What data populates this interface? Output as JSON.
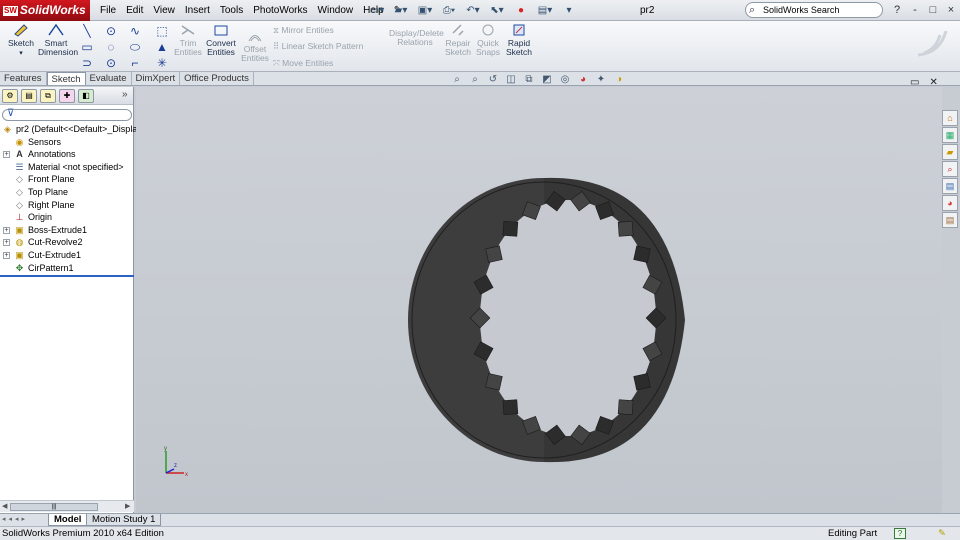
{
  "app": {
    "name": "SolidWorks",
    "logo_text": "SW"
  },
  "menu": [
    "File",
    "Edit",
    "View",
    "Insert",
    "Tools",
    "PhotoWorks",
    "Window",
    "Help"
  ],
  "document_title": "pr2",
  "search": {
    "placeholder": "SolidWorks Search"
  },
  "window_controls": [
    "?",
    "-",
    "□",
    "×"
  ],
  "ribbon": {
    "sketch": "Sketch",
    "smart_dimension_1": "Smart",
    "smart_dimension_2": "Dimension",
    "trim_1": "Trim",
    "trim_2": "Entities",
    "convert_1": "Convert",
    "convert_2": "Entities",
    "offset_1": "Offset",
    "offset_2": "Entities",
    "mirror": "Mirror Entities",
    "linear_pattern": "Linear Sketch Pattern",
    "move": "Move Entities",
    "display_delete_1": "Display/Delete",
    "display_delete_2": "Relations",
    "repair_1": "Repair",
    "repair_2": "Sketch",
    "quick_snaps_1": "Quick",
    "quick_snaps_2": "Snaps",
    "rapid_sketch_1": "Rapid",
    "rapid_sketch_2": "Sketch"
  },
  "command_tabs": [
    "Features",
    "Sketch",
    "Evaluate",
    "DimXpert",
    "Office Products"
  ],
  "active_tab": "Sketch",
  "feature_tree": {
    "root": "pr2  (Default<<Default>_Display",
    "items": [
      {
        "label": "Sensors",
        "icon": "sensor-icon",
        "expandable": false
      },
      {
        "label": "Annotations",
        "icon": "annotation-icon",
        "expandable": true
      },
      {
        "label": "Material <not specified>",
        "icon": "material-icon",
        "expandable": false
      },
      {
        "label": "Front Plane",
        "icon": "plane-icon",
        "expandable": false
      },
      {
        "label": "Top Plane",
        "icon": "plane-icon",
        "expandable": false
      },
      {
        "label": "Right Plane",
        "icon": "plane-icon",
        "expandable": false
      },
      {
        "label": "Origin",
        "icon": "origin-icon",
        "expandable": false
      },
      {
        "label": "Boss-Extrude1",
        "icon": "extrude-icon",
        "expandable": true
      },
      {
        "label": "Cut-Revolve2",
        "icon": "revolve-icon",
        "expandable": true
      },
      {
        "label": "Cut-Extrude1",
        "icon": "cut-icon",
        "expandable": true
      },
      {
        "label": "CirPattern1",
        "icon": "pattern-icon",
        "expandable": false
      }
    ]
  },
  "triad": {
    "x": "x",
    "y": "y",
    "z": "z"
  },
  "bottom_tabs": [
    "Model",
    "Motion Study 1"
  ],
  "status": {
    "left": "SolidWorks Premium 2010 x64 Edition",
    "mode": "Editing Part",
    "help": "?"
  },
  "colors": {
    "part": "#3a3a3a",
    "viewport": "#c6cad0",
    "logo": "#c8141b",
    "rollback": "#2a62c4"
  }
}
